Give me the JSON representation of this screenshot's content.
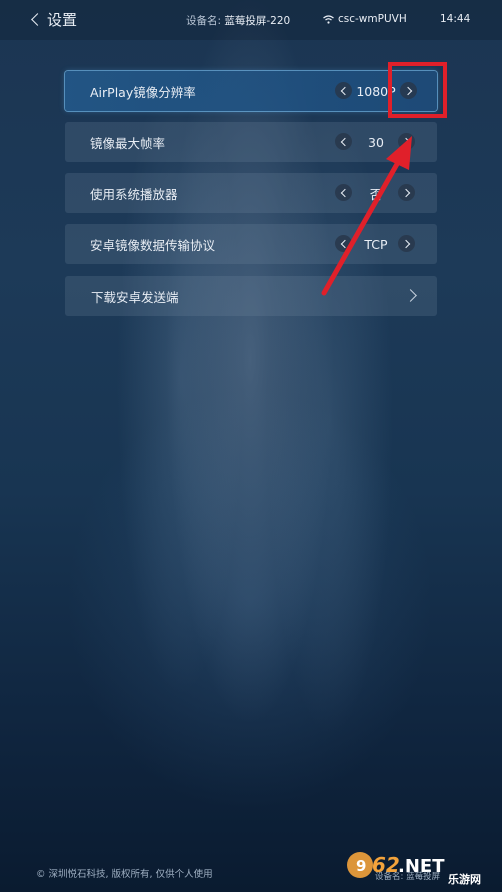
{
  "header": {
    "back_label": "设置",
    "device_label": "设备名:",
    "device_name": "蓝莓投屏-220",
    "wifi_name": "csc-wmPUVH",
    "time": "14:44"
  },
  "settings": [
    {
      "label": "AirPlay镜像分辨率",
      "value": "1080P"
    },
    {
      "label": "镜像最大帧率",
      "value": "30"
    },
    {
      "label": "使用系统播放器",
      "value": "否"
    },
    {
      "label": "安卓镜像数据传输协议",
      "value": "TCP"
    },
    {
      "label": "下载安卓发送端"
    }
  ],
  "footer": {
    "copyright": "© 深圳悦石科技, 版权所有, 仅供个人使用"
  },
  "watermark": {
    "brand": "962.NET",
    "tagline": "乐游网",
    "device_prefix": "设备名:",
    "device_partial": "蓝莓投屏"
  },
  "colors": {
    "highlight_box": "#e0202a",
    "arrow": "#e0202a",
    "active_row": "#23598c"
  }
}
